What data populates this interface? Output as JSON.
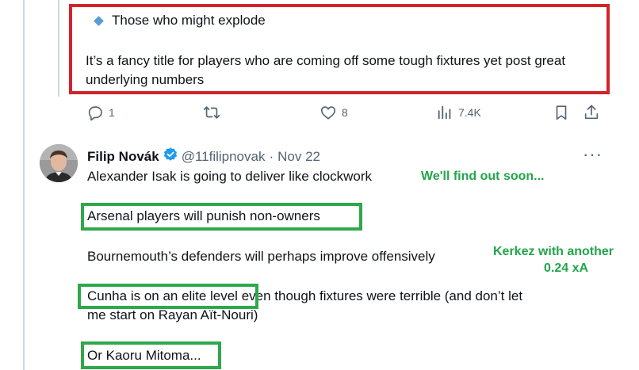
{
  "tweet1": {
    "bullet_text": "Those who might explode",
    "paragraph": "It’s a fancy title for players who are coming off some tough fixtures yet post great underlying numbers",
    "replies": "1",
    "likes": "8",
    "views": "7.4K"
  },
  "tweet2": {
    "author_name": "Filip Novák",
    "handle": "@11filipnovak",
    "separator": "·",
    "date": "Nov 22",
    "more": "···",
    "line1": "Alexander Isak is going to deliver like clockwork",
    "line2": "Arsenal players will punish non-owners",
    "line3": "Bournemouth’s defenders will perhaps improve offensively",
    "line4a": "Cunha is on an elite level",
    "line4b": " even though fixtures were terrible (and don’t let",
    "line5": "me start on Rayan Aït-Nouri)",
    "line6": "Or Kaoru Mitoma..."
  },
  "annotations": {
    "note1": "We'll find out soon...",
    "note2_line1": "Kerkez with another",
    "note2_line2": "0.24 xA"
  },
  "colors": {
    "red_box": "#d0232b",
    "green_box": "#2fa84c",
    "green_text": "#21a649",
    "verified": "#1d9bf0",
    "secondary_text": "#536471"
  }
}
